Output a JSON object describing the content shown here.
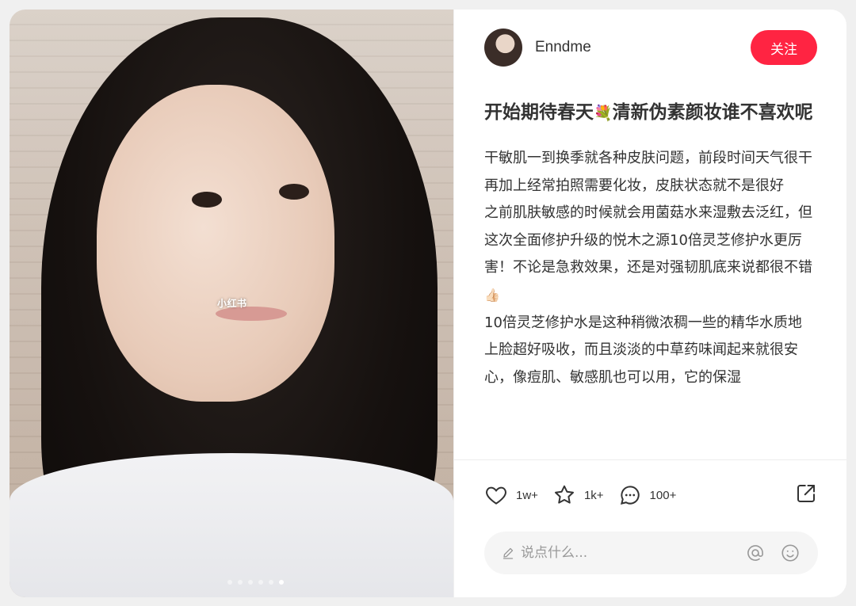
{
  "media": {
    "watermark": "小红书",
    "carousel": {
      "total": 6,
      "active_index": 5
    }
  },
  "author": {
    "name": "Enndme",
    "follow_label": "关注"
  },
  "post": {
    "title_part1": "开始期待春天",
    "title_emoji": "💐",
    "title_part2": "清新伪素颜妆谁不喜欢呢",
    "desc": {
      "p1": "干敏肌一到换季就各种皮肤问题，前段时间天气很干 再加上经常拍照需要化妆，皮肤状态就不是很好",
      "p2": "之前肌肤敏感的时候就会用菌菇水来湿敷去泛红，但这次全面修护升级的悦木之源10倍灵芝修护水更厉害！不论是急救效果，还是对强韧肌底来说都很不错",
      "p2_emoji": "👍🏻",
      "p3": "10倍灵芝修护水是这种稍微浓稠一些的精华水质地 上脸超好吸收，而且淡淡的中草药味闻起来就很安心，像痘肌、敏感肌也可以用，它的保湿"
    }
  },
  "engagement": {
    "likes": "1w+",
    "collects": "1k+",
    "comments": "100+"
  },
  "comment_input": {
    "placeholder": "说点什么..."
  },
  "colors": {
    "accent": "#ff2442",
    "text": "#333333",
    "input_bg": "#f5f5f5"
  },
  "icons": [
    "heart-icon",
    "star-icon",
    "comment-icon",
    "share-icon",
    "pen-icon",
    "at-icon",
    "emoji-icon"
  ]
}
